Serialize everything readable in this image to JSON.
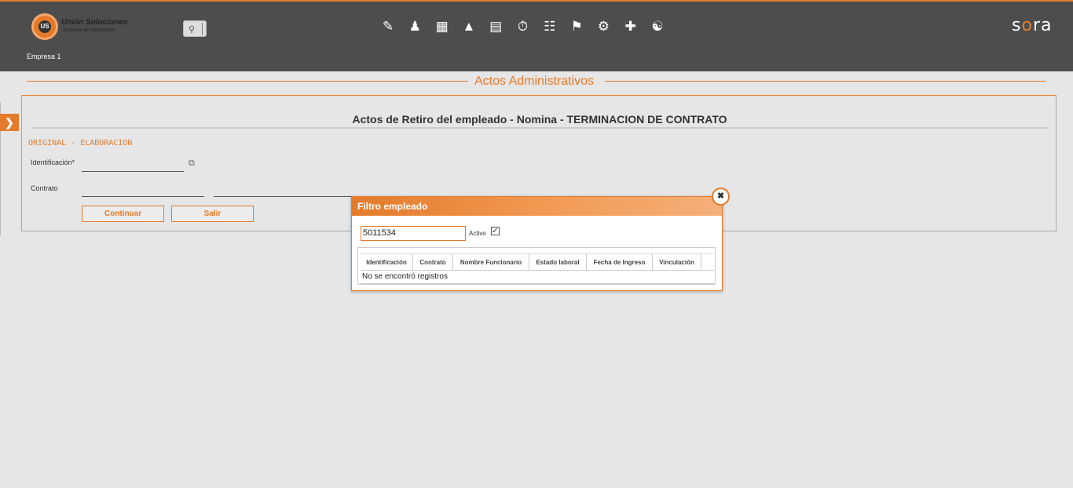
{
  "header": {
    "logo_name": "Unión Soluciones",
    "logo_sub": "Sistemas de Información",
    "company": "Empresa 1",
    "brand": "sora",
    "nav_icons": [
      "edit-doc-icon",
      "user-money-icon",
      "gift-icon",
      "org-chart-icon",
      "id-card-icon",
      "stopwatch-icon",
      "report-icon",
      "training-icon",
      "settings-gears-icon",
      "medical-kit-icon",
      "group-search-icon"
    ]
  },
  "section": {
    "title": "Actos Administrativos"
  },
  "form": {
    "title": "Actos de Retiro del empleado - Nomina - TERMINACION DE CONTRATO",
    "status": "ORIGINAL - ELABORACION",
    "identificacion_label": "Identificación*",
    "contrato_label": "Contrato",
    "continuar_label": "Continuar",
    "salir_label": "Salir"
  },
  "dialog": {
    "title": "Filtro empleado",
    "filter_value": "5011534",
    "activo_label": "Activo",
    "activo_checked": true,
    "columns": [
      "Identificación",
      "Contrato",
      "Nombre Funcionario",
      "Estado laboral",
      "Fecha de Ingreso",
      "Vinculación"
    ],
    "empty_message": "No se encontró registros"
  },
  "colors": {
    "accent": "#e37b2b",
    "header_bg": "#4d4d4d",
    "page_bg": "#e6e6e6"
  }
}
